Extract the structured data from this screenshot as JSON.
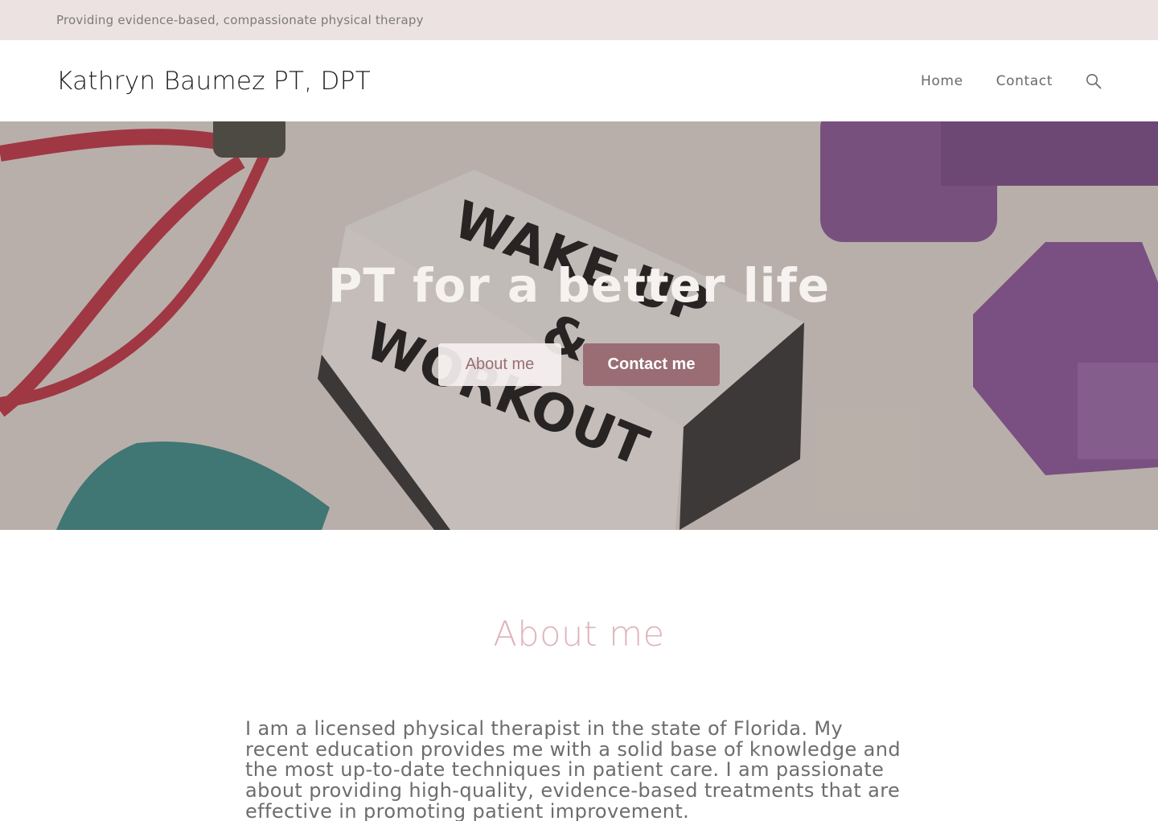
{
  "topbar": {
    "tagline": "Providing evidence-based, compassionate physical therapy"
  },
  "header": {
    "site_title": "Kathryn Baumez PT, DPT",
    "nav": [
      {
        "label": "Home"
      },
      {
        "label": "Contact"
      }
    ],
    "search_icon": "search-icon"
  },
  "hero": {
    "title": "PT for a better life",
    "about_button": "About me",
    "contact_button": "Contact me",
    "background_text": [
      "WAKE UP",
      "&",
      "WORKOUT"
    ]
  },
  "about": {
    "heading": "About me",
    "body": "I am a licensed physical therapist in the state of Florida. My recent education provides me with a solid base of knowledge and the most up-to-date techniques in patient care. I am passionate about providing high-quality, evidence-based treatments that are effective in promoting patient improvement."
  },
  "colors": {
    "topbar_bg": "#ede2e2",
    "accent": "#9a6d74",
    "heading_pink": "#dfb4bc"
  }
}
